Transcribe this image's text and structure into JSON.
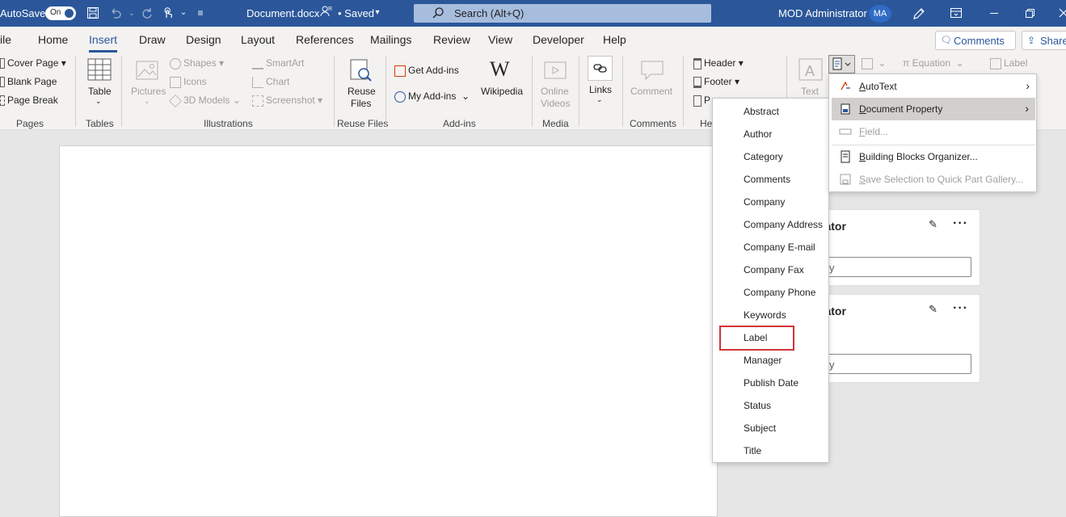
{
  "titlebar": {
    "autosave": "AutoSave",
    "toggle": "On",
    "doc_title": "Document.docx",
    "saved": "• Saved",
    "search_placeholder": "Search (Alt+Q)",
    "user": "MOD Administrator",
    "avatar": "MA"
  },
  "menubar": {
    "tabs": [
      "ile",
      "Home",
      "Insert",
      "Draw",
      "Design",
      "Layout",
      "References",
      "Mailings",
      "Review",
      "View",
      "Developer",
      "Help"
    ],
    "active": "Insert",
    "comments": "Comments",
    "share": "Share"
  },
  "ribbon": {
    "pages": {
      "label": "Pages",
      "items": [
        "Cover Page",
        "Blank Page",
        "Page Break"
      ]
    },
    "tables": {
      "label": "Tables",
      "table": "Table"
    },
    "illustrations": {
      "label": "Illustrations",
      "pictures": "Pictures",
      "shapes": "Shapes",
      "icons": "Icons",
      "models": "3D Models",
      "smartart": "SmartArt",
      "chart": "Chart",
      "screenshot": "Screenshot"
    },
    "reuse": {
      "label": "Reuse Files",
      "button_line1": "Reuse",
      "button_line2": "Files"
    },
    "addins": {
      "label": "Add-ins",
      "get": "Get Add-ins",
      "my": "My Add-ins",
      "wikipedia": "Wikipedia"
    },
    "media": {
      "label": "Media",
      "line1": "Online",
      "line2": "Videos"
    },
    "links": {
      "label": "Links"
    },
    "comments": {
      "label": "Comments",
      "comment": "Comment"
    },
    "header_footer": {
      "label": "He",
      "header": "Header",
      "footer": "Footer",
      "page_number": "P"
    },
    "text": {
      "text": "Text",
      "equation": "Equation",
      "label_btn": "Label"
    }
  },
  "comment_cards": [
    {
      "name": "rator",
      "reply": "y"
    },
    {
      "name": "rator",
      "reply": "y"
    }
  ],
  "quick_parts_menu": [
    {
      "label": "AutoText",
      "underline": "A",
      "rest": "utoText",
      "arrow": true,
      "disabled": false
    },
    {
      "label": "Document Property",
      "underline": "D",
      "rest": "ocument Property",
      "arrow": true,
      "disabled": false,
      "hover": true
    },
    {
      "label": "Field...",
      "underline": "F",
      "rest": "ield...",
      "arrow": false,
      "disabled": true
    },
    {
      "label": "Building Blocks Organizer...",
      "underline": "B",
      "rest": "uilding Blocks Organizer...",
      "arrow": false,
      "disabled": false
    },
    {
      "label": "Save Selection to Quick Part Gallery...",
      "underline": "S",
      "rest": "ave Selection to Quick Part Gallery...",
      "arrow": false,
      "disabled": true
    }
  ],
  "document_property_submenu": [
    "Abstract",
    "Author",
    "Category",
    "Comments",
    "Company",
    "Company Address",
    "Company E-mail",
    "Company Fax",
    "Company Phone",
    "Keywords",
    "Label",
    "Manager",
    "Publish Date",
    "Status",
    "Subject",
    "Title"
  ],
  "highlighted_item": "Label",
  "colors": {
    "accent": "#2b579a",
    "highlight": "#d13438"
  }
}
